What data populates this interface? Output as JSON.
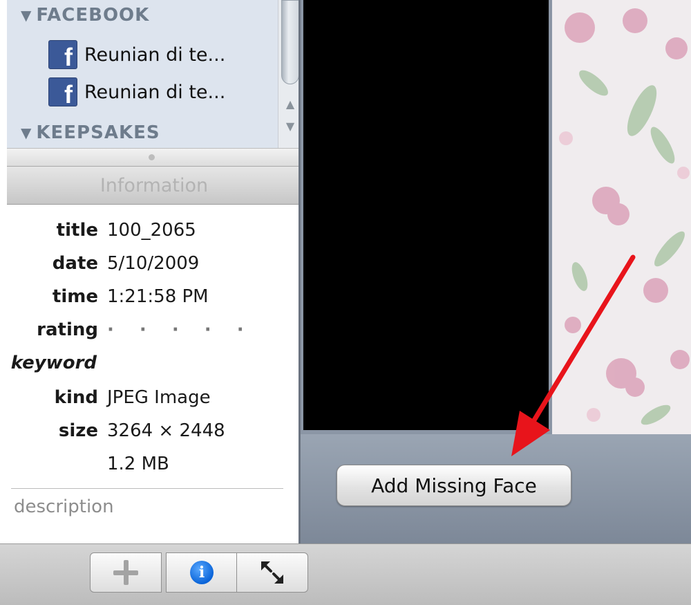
{
  "source_list": {
    "sections": [
      {
        "label": "FACEBOOK",
        "items": [
          {
            "label": "Reunian di te..."
          },
          {
            "label": "Reunian di te..."
          }
        ]
      },
      {
        "label": "KEEPSAKES"
      }
    ]
  },
  "info_panel": {
    "header": "Information",
    "rows": [
      {
        "key": "title",
        "value": "100_2065"
      },
      {
        "key": "date",
        "value": "5/10/2009"
      },
      {
        "key": "time",
        "value": "1:21:58 PM"
      },
      {
        "key": "rating",
        "value": "· · · · ·"
      },
      {
        "key": "keyword",
        "value": ""
      },
      {
        "key": "kind",
        "value": "JPEG Image"
      },
      {
        "key": "size",
        "value": "3264 × 2448"
      },
      {
        "key": "",
        "value": "1.2 MB"
      }
    ],
    "description_placeholder": "description"
  },
  "viewer": {
    "add_missing_face_label": "Add Missing Face"
  },
  "toolbar": {
    "add_icon": "plus-icon",
    "info_icon": "info-icon",
    "fullscreen_icon": "expand-arrows-icon",
    "info_glyph": "i"
  },
  "colors": {
    "source_list_bg": "#dde4ee",
    "section_header": "#6e7c8c",
    "facebook_blue": "#3b5998",
    "viewer_bg": "#8b96a5",
    "annotation_arrow": "#e8141b",
    "info_icon_blue": "#0a64d8"
  }
}
